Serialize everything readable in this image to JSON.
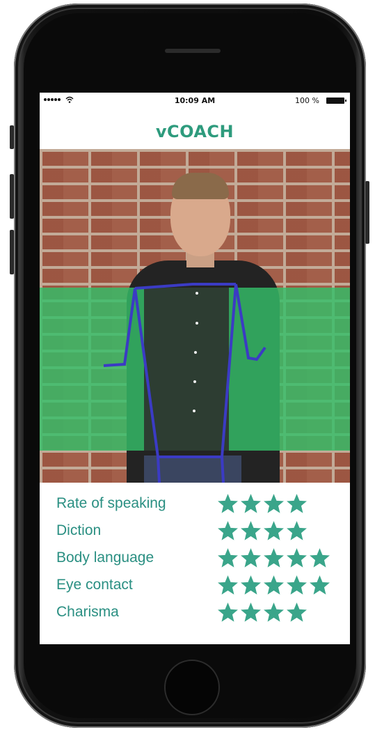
{
  "status_bar": {
    "time": "10:09 AM",
    "battery": "100 %"
  },
  "app": {
    "title": "vCOACH"
  },
  "ratings": [
    {
      "label": "Rate of speaking",
      "stars": 4
    },
    {
      "label": "Diction",
      "stars": 4
    },
    {
      "label": "Body language",
      "stars": 5
    },
    {
      "label": "Eye contact",
      "stars": 5
    },
    {
      "label": "Charisma",
      "stars": 4
    }
  ],
  "colors": {
    "accent": "#2e9b7d",
    "star": "#3aa58a",
    "overlay": "#34be69",
    "skeleton": "#3b3bc4"
  },
  "icons": {
    "signal": "signal-dots-icon",
    "wifi": "wifi-icon",
    "battery": "battery-icon",
    "star": "star-icon"
  }
}
